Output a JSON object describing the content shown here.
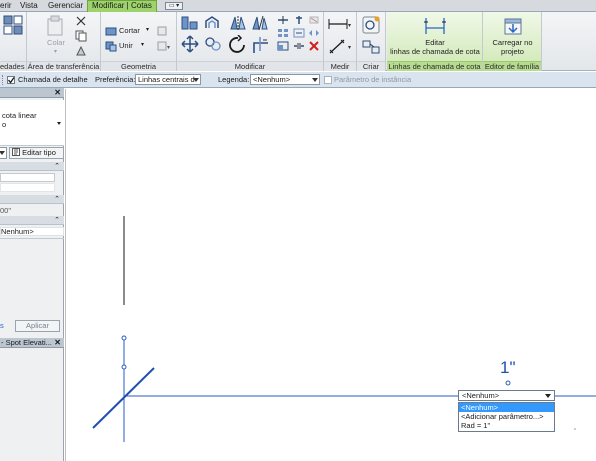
{
  "tabs": [
    "erir",
    "Vista",
    "Gerenciar",
    "Modificar | Cotas"
  ],
  "tab_extra": "▭ ▾",
  "ribbon": {
    "prop_fragment": "edades",
    "clipboard": {
      "paste_label": "Colar",
      "title": "Área de transferência"
    },
    "geometry": {
      "cut_label": "Cortar",
      "join_label": "Unir",
      "title": "Geometria"
    },
    "modify": {
      "title": "Modificar"
    },
    "measure": {
      "title": "Medir"
    },
    "create": {
      "title": "Criar"
    },
    "leader": {
      "button_line1": "Editar",
      "button_line2": "linhas de chamada de cota",
      "title": "Linhas de chamada de cota"
    },
    "family": {
      "button_line1": "Carregar no",
      "button_line2": "projeto",
      "title": "Editor de família"
    }
  },
  "options_bar": {
    "leader_label": "Chamada de detalhe",
    "leader_checked": true,
    "preference_label": "Preferência:",
    "preference_value": "Linhas centrais d",
    "legend_label": "Legenda:",
    "legend_value": "<Nenhum>",
    "instance_param_label": "Parâmetro de instância",
    "instance_param_checked": false
  },
  "properties": {
    "type_line1": "cota linear",
    "type_line2": "o",
    "edit_type_label": "Editar tipo",
    "value_fragment": "00\"",
    "label_value": "Nenhum>",
    "apply_fragment": "s",
    "apply_label": "Aplicar",
    "browser_title": "- Spot Elevati..."
  },
  "canvas": {
    "dimension_text": "1\"",
    "dropdown": {
      "value": "<Nenhum>",
      "options": [
        "<Nenhum>",
        "<Adicionar parâmetro...>",
        "Rad = 1\""
      ],
      "selected_index": 0
    }
  },
  "colors": {
    "accent": "#9ed36b",
    "dimension": "#1f4fb0",
    "selection": "#3399ff"
  }
}
